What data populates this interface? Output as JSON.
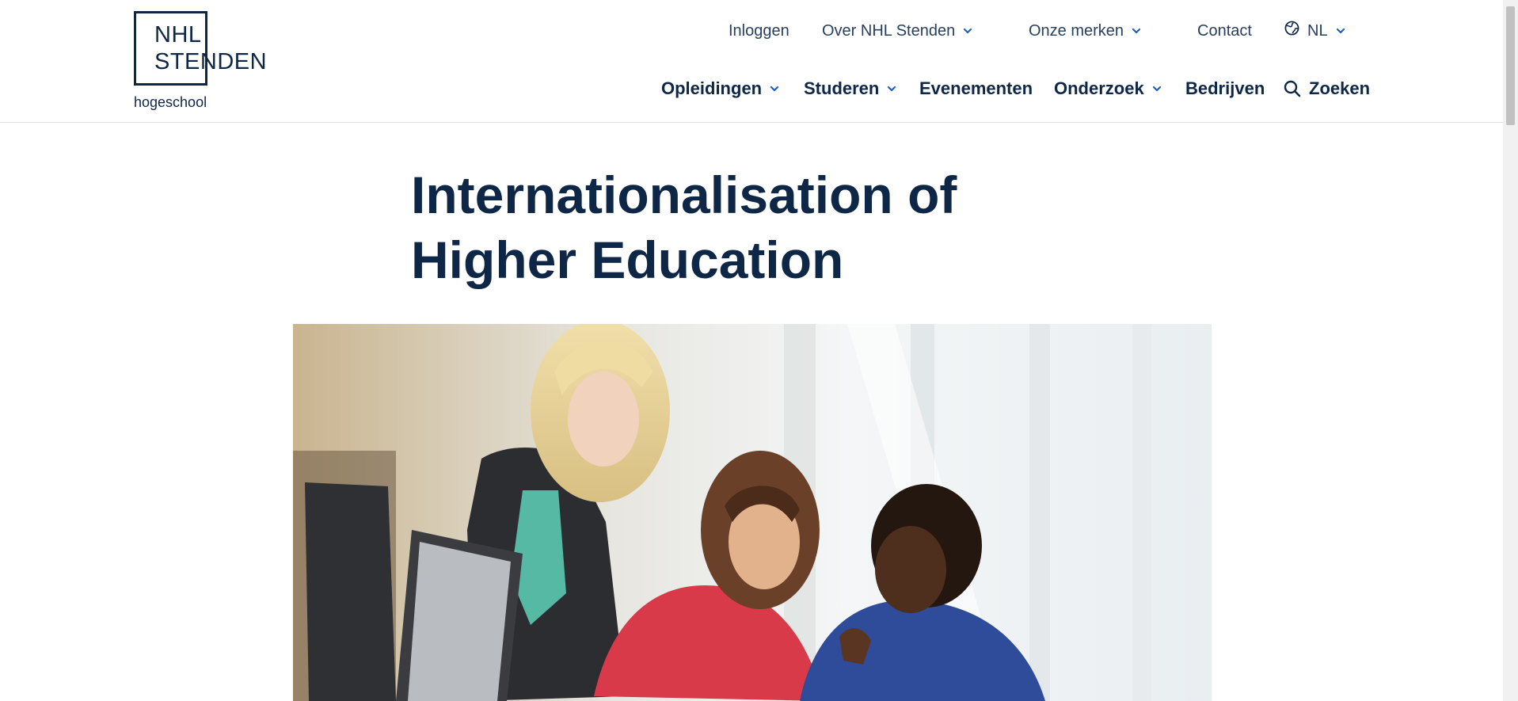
{
  "header": {
    "logo": {
      "line1": "NHL",
      "line2": "STENDEN",
      "sub": "hogeschool"
    },
    "top_nav": [
      {
        "label": "Inloggen",
        "has_dropdown": false
      },
      {
        "label": "Over NHL Stenden",
        "has_dropdown": true
      },
      {
        "label": "Onze merken",
        "has_dropdown": true
      },
      {
        "label": "Contact",
        "has_dropdown": false
      },
      {
        "label": "NL",
        "has_dropdown": true,
        "icon": "globe-icon"
      }
    ],
    "main_nav": [
      {
        "label": "Opleidingen",
        "has_dropdown": true
      },
      {
        "label": "Studeren",
        "has_dropdown": true
      },
      {
        "label": "Evenementen",
        "has_dropdown": false
      },
      {
        "label": "Onderzoek",
        "has_dropdown": true
      },
      {
        "label": "Bedrijven",
        "has_dropdown": false
      },
      {
        "label": "Zoeken",
        "has_dropdown": false,
        "icon": "search-icon"
      }
    ]
  },
  "main": {
    "title_line1": "Internationalisation of",
    "title_line2": "Higher Education"
  },
  "colors": {
    "brand_navy": "#0f2747",
    "accent_blue": "#1f5fbf"
  }
}
